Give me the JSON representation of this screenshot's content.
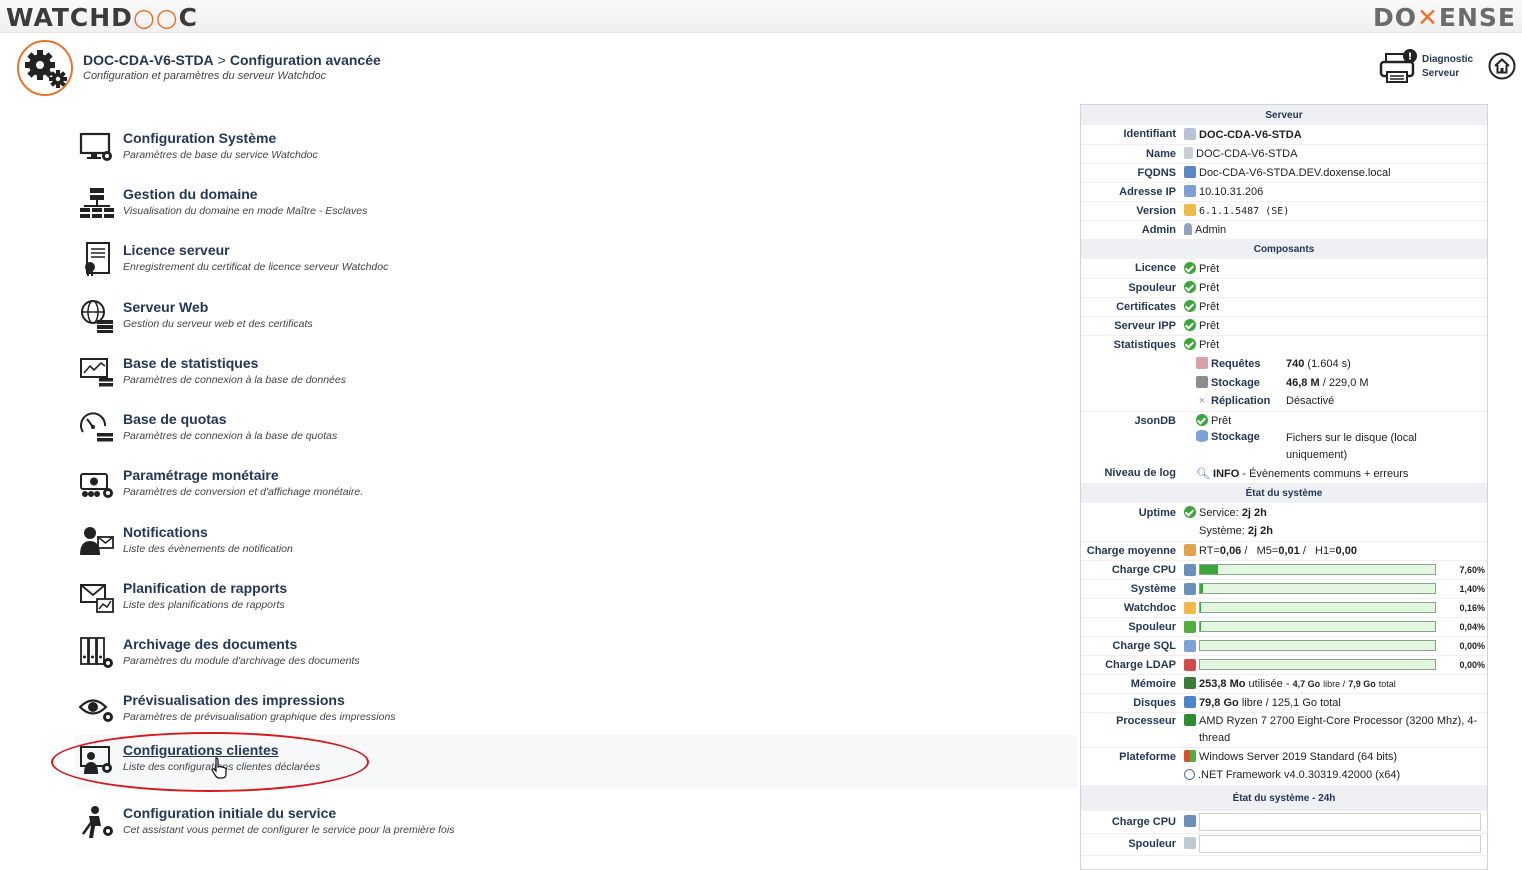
{
  "logos": {
    "left": "WATCHDOC",
    "right": "DOXENSE"
  },
  "header": {
    "server": "DOC-CDA-V6-STDA",
    "separator": ">",
    "title": "Configuration avancée",
    "subtitle": "Configuration et paramètres du serveur Watchdoc",
    "diagnostic_line1": "Diagnostic",
    "diagnostic_line2": "Serveur"
  },
  "menu": [
    {
      "title": "Configuration Système",
      "desc": "Paramètres de base du service Watchdoc",
      "icon": "monitor-gear-icon"
    },
    {
      "title": "Gestion du domaine",
      "desc": "Visualisation du domaine en mode Maître - Esclaves",
      "icon": "server-tree-icon"
    },
    {
      "title": "Licence serveur",
      "desc": "Enregistrement du certificat de licence serveur Watchdoc",
      "icon": "certificate-icon"
    },
    {
      "title": "Serveur Web",
      "desc": "Gestion du serveur web et des certificats",
      "icon": "globe-server-icon"
    },
    {
      "title": "Base de statistiques",
      "desc": "Paramètres de connexion à la base de données",
      "icon": "stats-database-icon"
    },
    {
      "title": "Base de quotas",
      "desc": "Paramètres de connexion à la base de quotas",
      "icon": "gauge-database-icon"
    },
    {
      "title": "Paramétrage monétaire",
      "desc": "Paramètres de conversion et d'affichage monétaire.",
      "icon": "money-gear-icon"
    },
    {
      "title": "Notifications",
      "desc": "Liste des évènements de notification",
      "icon": "user-mail-icon"
    },
    {
      "title": "Planification de rapports",
      "desc": "Liste des planifications de rapports",
      "icon": "mail-chart-icon"
    },
    {
      "title": "Archivage des documents",
      "desc": "Paramètres du module d'archivage des documents",
      "icon": "archive-binders-icon"
    },
    {
      "title": "Prévisualisation des impressions",
      "desc": "Paramètres de prévisualisation graphique des impressions",
      "icon": "eye-gear-icon"
    },
    {
      "title": "Configurations clientes",
      "desc": "Liste des configurations clientes déclarées",
      "icon": "client-config-icon"
    },
    {
      "title": "Configuration initiale du service",
      "desc": "Cet assistant vous permet de configurer le service pour la première fois",
      "icon": "wizard-gear-icon"
    }
  ],
  "panel": {
    "serveur": {
      "title": "Serveur",
      "identifiant_label": "Identifiant",
      "identifiant": "DOC-CDA-V6-STDA",
      "name_label": "Name",
      "name": "DOC-CDA-V6-STDA",
      "fqdns_label": "FQDNS",
      "fqdns": "Doc-CDA-V6-STDA.DEV.doxense.local",
      "ip_label": "Adresse IP",
      "ip": "10.10.31.206",
      "version_label": "Version",
      "version": "6.1.1.5487 (SE)",
      "admin_label": "Admin",
      "admin": "Admin"
    },
    "composants": {
      "title": "Composants",
      "licence_label": "Licence",
      "spouleur_label": "Spouleur",
      "certificates_label": "Certificates",
      "ipp_label": "Serveur IPP",
      "stats_label": "Statistiques",
      "ready": "Prêt",
      "requetes_label": "Requêtes",
      "requetes_value": "740",
      "requetes_time": "(1.604 s)",
      "stockage_label": "Stockage",
      "stockage_value": "46,8 M",
      "stockage_total": "/ 229,0 M",
      "replication_label": "Réplication",
      "replication_value": "Désactivé",
      "jsondb_label": "JsonDB",
      "json_stockage_line1": "Fichers sur le disque (local",
      "json_stockage_line2": "uniquement)",
      "log_label": "Niveau de log",
      "log_level": "INFO",
      "log_desc": "- Évènements communs + erreurs"
    },
    "systeme": {
      "title": "État du système",
      "uptime_label": "Uptime",
      "service_label": "Service:",
      "service_value": "2j 2h",
      "systeme_label": "Système:",
      "systeme_value": "2j 2h",
      "charge_label": "Charge moyenne",
      "rt_label": "RT=",
      "rt": "0,06",
      "m5_label": "M5=",
      "m5": "0,01",
      "h1_label": "H1=",
      "h1": "0,00",
      "slash": "/",
      "bars": [
        {
          "label": "Charge CPU",
          "value": 7.6,
          "text": "7,60%",
          "icon": "cpu-icon"
        },
        {
          "label": "Système",
          "value": 1.4,
          "text": "1,40%",
          "icon": "cpu-icon"
        },
        {
          "label": "Watchdoc",
          "value": 0.16,
          "text": "0,16%",
          "icon": "watchdoc-icon"
        },
        {
          "label": "Spouleur",
          "value": 0.04,
          "text": "0,04%",
          "icon": "windows-icon"
        },
        {
          "label": "Charge SQL",
          "value": 0.0,
          "text": "0,00%",
          "icon": "database-icon"
        },
        {
          "label": "Charge LDAP",
          "value": 0.0,
          "text": "0,00%",
          "icon": "ldap-icon"
        }
      ],
      "memoire_label": "Mémoire",
      "memoire_used": "253,8 Mo",
      "memoire_used_label": "utilisée",
      "memoire_free": "4,7 Go",
      "memoire_free_label": "libre /",
      "memoire_total": "7,9 Go",
      "memoire_total_label": "total",
      "disques_label": "Disques",
      "disques_free": "79,8 Go",
      "disques_rest": "libre / 125,1 Go total",
      "proc_label": "Processeur",
      "proc_line1": "AMD Ryzen 7 2700 Eight-Core Processor (3200 Mhz), 4-",
      "proc_line2": "thread",
      "plat_label": "Plateforme",
      "plat_os": "Windows Server 2019 Standard (64 bits)",
      "plat_net": ".NET Framework v4.0.30319.42000 (x64)"
    },
    "systeme24": {
      "title": "État du système - 24h",
      "cpu_label": "Charge CPU",
      "spouleur_label": "Spouleur"
    }
  }
}
